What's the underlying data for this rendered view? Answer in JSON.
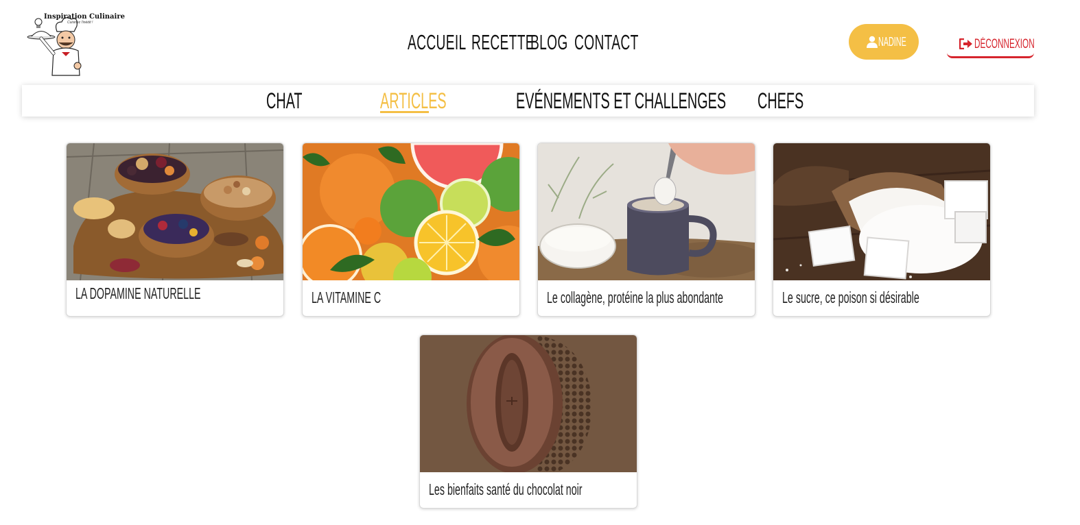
{
  "brand": {
    "name": "Inspiration Culinaire",
    "tagline": "Cuisinez l'inédit !"
  },
  "nav": {
    "items": [
      {
        "label": "Accueil"
      },
      {
        "label": "Recette"
      },
      {
        "label": "Blog"
      },
      {
        "label": "Contact"
      }
    ]
  },
  "user": {
    "name": "Nadine",
    "icon": "user-icon"
  },
  "logout": {
    "label": "Déconnexion",
    "icon": "sign-out-icon"
  },
  "subnav": {
    "tabs": [
      {
        "label": "Chat",
        "active": false
      },
      {
        "label": "Articles",
        "active": true
      },
      {
        "label": "Evénements et challenges",
        "active": false
      },
      {
        "label": "Chefs",
        "active": false
      }
    ]
  },
  "colors": {
    "accent": "#f4bf45",
    "danger": "#d6252d"
  },
  "articles": [
    {
      "title": "LA DOPAMINE NATURELLE",
      "image": "dried fruits and nuts in wooden bowls"
    },
    {
      "title": "LA VITAMINE C",
      "image": "citrus fruits"
    },
    {
      "title": "Le collagène, protéine la plus abondante",
      "image": "collagen powder spooned into a mug"
    },
    {
      "title": "Le sucre, ce poison si désirable",
      "image": "sugar cubes and granulated sugar in wooden scoop"
    },
    {
      "title": "Les bienfaits santé du chocolat noir",
      "image": "dark chocolate bean shape"
    }
  ]
}
